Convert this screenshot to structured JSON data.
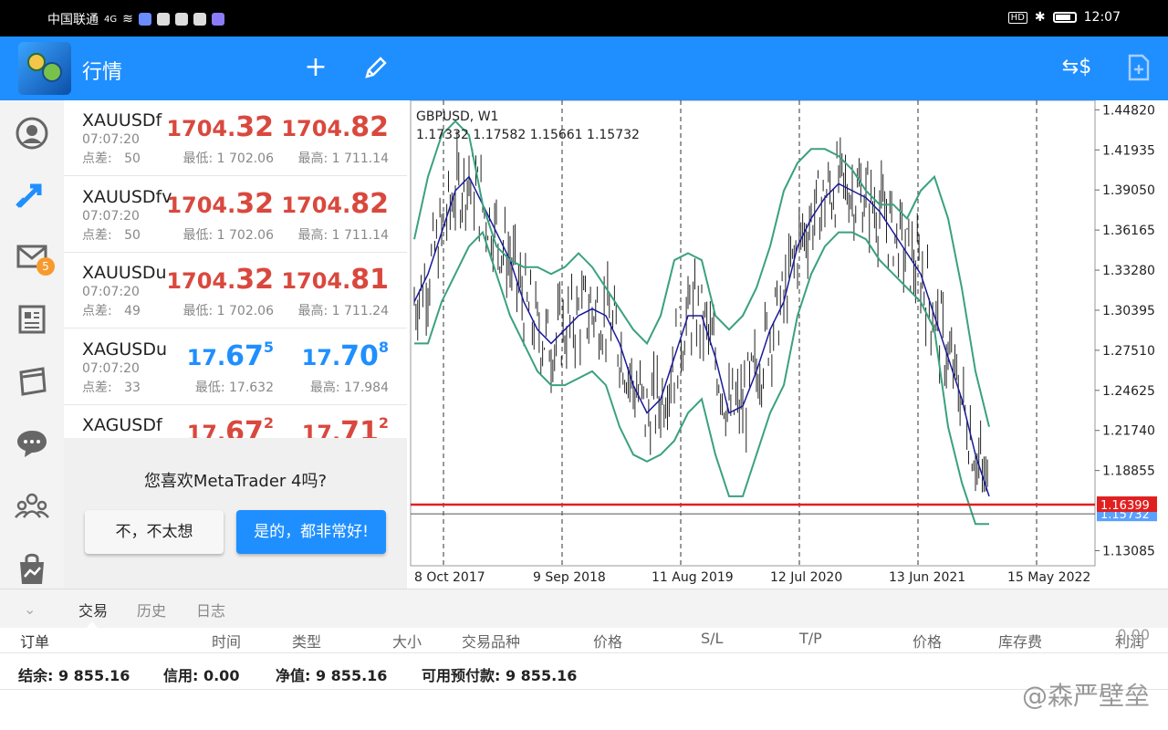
{
  "statusbar": {
    "carrier": "中国联通",
    "network": "4G",
    "time": "12:07",
    "hd": "HD"
  },
  "topbar": {
    "title": "行情",
    "add_icon": "plus-icon",
    "edit_icon": "pencil-icon",
    "currency_icon": "currency-exchange-icon",
    "new_doc_icon": "add-document-icon"
  },
  "sidebar": {
    "mail_badge": "5"
  },
  "quotes": [
    {
      "symbol": "XAUUSDf",
      "time": "07:07:20",
      "spread_label": "点差:",
      "spread": "50",
      "bid_main": "1704.",
      "bid_big": "32",
      "bid_sup": "",
      "ask_main": "1704.",
      "ask_big": "82",
      "ask_sup": "",
      "low": "最低: 1 702.06",
      "high": "最高: 1 711.14",
      "color": "red"
    },
    {
      "symbol": "XAUUSDfv",
      "time": "07:07:20",
      "spread_label": "点差:",
      "spread": "50",
      "bid_main": "1704.",
      "bid_big": "32",
      "bid_sup": "",
      "ask_main": "1704.",
      "ask_big": "82",
      "ask_sup": "",
      "low": "最低: 1 702.06",
      "high": "最高: 1 711.14",
      "color": "red"
    },
    {
      "symbol": "XAUUSDu",
      "time": "07:07:20",
      "spread_label": "点差:",
      "spread": "49",
      "bid_main": "1704.",
      "bid_big": "32",
      "bid_sup": "",
      "ask_main": "1704.",
      "ask_big": "81",
      "ask_sup": "",
      "low": "最低: 1 702.06",
      "high": "最高: 1 711.24",
      "color": "red"
    },
    {
      "symbol": "XAGUSDu",
      "time": "07:07:20",
      "spread_label": "点差:",
      "spread": "33",
      "bid_main": "17.",
      "bid_big": "67",
      "bid_sup": "5",
      "ask_main": "17.",
      "ask_big": "70",
      "ask_sup": "8",
      "low": "最低: 17.632",
      "high": "最高: 17.984",
      "color": "blue"
    },
    {
      "symbol": "XAGUSDf",
      "time": "",
      "spread_label": "",
      "spread": "",
      "bid_main": "17.",
      "bid_big": "67",
      "bid_sup": "2",
      "ask_main": "17.",
      "ask_big": "71",
      "ask_sup": "2",
      "low": "",
      "high": "",
      "color": "red"
    }
  ],
  "rating": {
    "question": "您喜欢MetaTrader 4吗?",
    "no_label": "不，不太想",
    "yes_label": "是的，都非常好!"
  },
  "chart": {
    "symbol_tf": "GBPUSD, W1",
    "ohlc": "1.17332 1.17582 1.15661 1.15732",
    "current_price": "1.16399",
    "last_price": "1.15732",
    "accent": "#1f8fff",
    "band_color": "#3aa17e",
    "ma_color": "#1a1a9a",
    "price_line_color": "#e02020"
  },
  "chart_data": {
    "type": "line",
    "title": "GBPUSD, W1",
    "y_ticks": [
      "1.44820",
      "1.41935",
      "1.39050",
      "1.36165",
      "1.33280",
      "1.30395",
      "1.27510",
      "1.24625",
      "1.21740",
      "1.18855",
      "1.13085"
    ],
    "x_ticks": [
      "8 Oct 2017",
      "9 Sep 2018",
      "11 Aug 2019",
      "12 Jul 2020",
      "13 Jun 2021",
      "15 May 2022"
    ],
    "ylim": [
      1.12,
      1.455
    ],
    "series": [
      {
        "values": [
          1.31,
          1.33,
          1.36,
          1.39,
          1.4,
          1.38,
          1.36,
          1.34,
          1.31,
          1.29,
          1.28,
          1.29,
          1.3,
          1.305,
          1.3,
          1.28,
          1.25,
          1.23,
          1.24,
          1.27,
          1.3,
          1.3,
          1.27,
          1.23,
          1.235,
          1.26,
          1.29,
          1.31,
          1.35,
          1.37,
          1.385,
          1.395,
          1.39,
          1.385,
          1.375,
          1.36,
          1.345,
          1.33,
          1.3,
          1.27,
          1.24,
          1.2,
          1.17
        ]
      },
      {
        "values": [
          1.355,
          1.4,
          1.43,
          1.44,
          1.43,
          1.38,
          1.35,
          1.34,
          1.335,
          1.335,
          1.33,
          1.335,
          1.345,
          1.335,
          1.32,
          1.305,
          1.29,
          1.28,
          1.3,
          1.34,
          1.345,
          1.34,
          1.3,
          1.29,
          1.3,
          1.32,
          1.35,
          1.39,
          1.41,
          1.42,
          1.42,
          1.415,
          1.405,
          1.39,
          1.38,
          1.38,
          1.37,
          1.39,
          1.4,
          1.37,
          1.32,
          1.26,
          1.22
        ]
      },
      {
        "values": [
          1.28,
          1.28,
          1.31,
          1.33,
          1.35,
          1.36,
          1.33,
          1.3,
          1.28,
          1.26,
          1.25,
          1.25,
          1.255,
          1.26,
          1.25,
          1.22,
          1.2,
          1.195,
          1.2,
          1.21,
          1.23,
          1.24,
          1.2,
          1.17,
          1.17,
          1.2,
          1.23,
          1.25,
          1.3,
          1.33,
          1.35,
          1.36,
          1.36,
          1.355,
          1.34,
          1.33,
          1.32,
          1.31,
          1.29,
          1.22,
          1.18,
          1.15,
          1.15
        ]
      }
    ]
  },
  "bottom": {
    "tabs": [
      "交易",
      "历史",
      "日志"
    ],
    "columns": [
      "订单",
      "时间",
      "类型",
      "大小",
      "交易品种",
      "价格",
      "S/L",
      "T/P",
      "价格",
      "库存费",
      "利润"
    ],
    "balance": "结余: 9 855.16",
    "credit": "信用: 0.00",
    "equity": "净值: 9 855.16",
    "free_margin": "可用预付款: 9 855.16",
    "profit_total": "0.00",
    "watermark": "@森严壁垒"
  }
}
